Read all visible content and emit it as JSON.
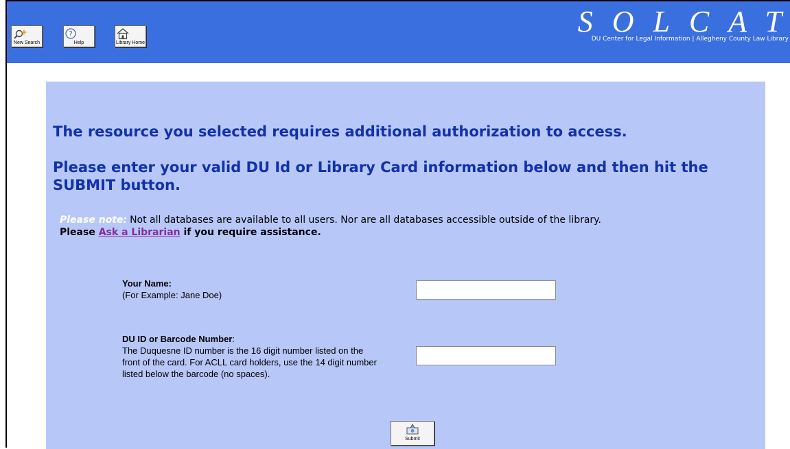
{
  "toolbar": {
    "buttons": [
      {
        "label": "New Search",
        "icon": "magnifier-sparkle-icon"
      },
      {
        "label": "Help",
        "icon": "question-circle-icon"
      },
      {
        "label": "Library Home",
        "icon": "house-icon"
      }
    ]
  },
  "brand": {
    "logo_text": "SOLCAT",
    "subtitle": "DU Center for Legal Information | Allegheny County Law Library"
  },
  "main": {
    "heading_1": "The resource you selected requires additional authorization to access.",
    "heading_2": "Please enter your valid DU Id or Library Card information below and then hit the SUBMIT button.",
    "note": {
      "label": "Please note:",
      "text": "Not all databases are available to all users. Nor are all databases accessible outside of the library.",
      "line2_prefix": "Please ",
      "link": "Ask a Librarian",
      "line2_suffix": " if you require assistance."
    },
    "form": {
      "name_label": "Your Name:",
      "name_example": "(For Example: Jane Doe)",
      "name_value": "",
      "id_label": "DU ID or Barcode Number",
      "id_label_colon": ":",
      "id_help": "The Duquesne ID number is the 16 digit number listed on the front of the card.  For ACLL card holders, use the 14 digit number listed below the barcode (no spaces).",
      "id_value": "",
      "submit_label": "Submit"
    }
  },
  "colors": {
    "header_bg": "#3a6fdf",
    "panel_bg": "#b7c7f8",
    "heading": "#1232a8",
    "link": "#8a2b9e"
  }
}
